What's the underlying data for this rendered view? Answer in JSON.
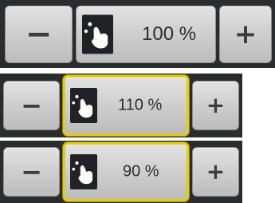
{
  "accent_color": "#e2cc17",
  "controls": [
    {
      "minus_label": "−",
      "plus_label": "+",
      "zoom_label": "100 %",
      "zoom_icon": "hand-zoom-icon",
      "selected": false
    },
    {
      "minus_label": "−",
      "plus_label": "+",
      "zoom_label": "110 %",
      "zoom_icon": "hand-zoom-icon",
      "selected": true
    },
    {
      "minus_label": "−",
      "plus_label": "+",
      "zoom_label": "90 %",
      "zoom_icon": "hand-zoom-icon",
      "selected": true
    }
  ]
}
